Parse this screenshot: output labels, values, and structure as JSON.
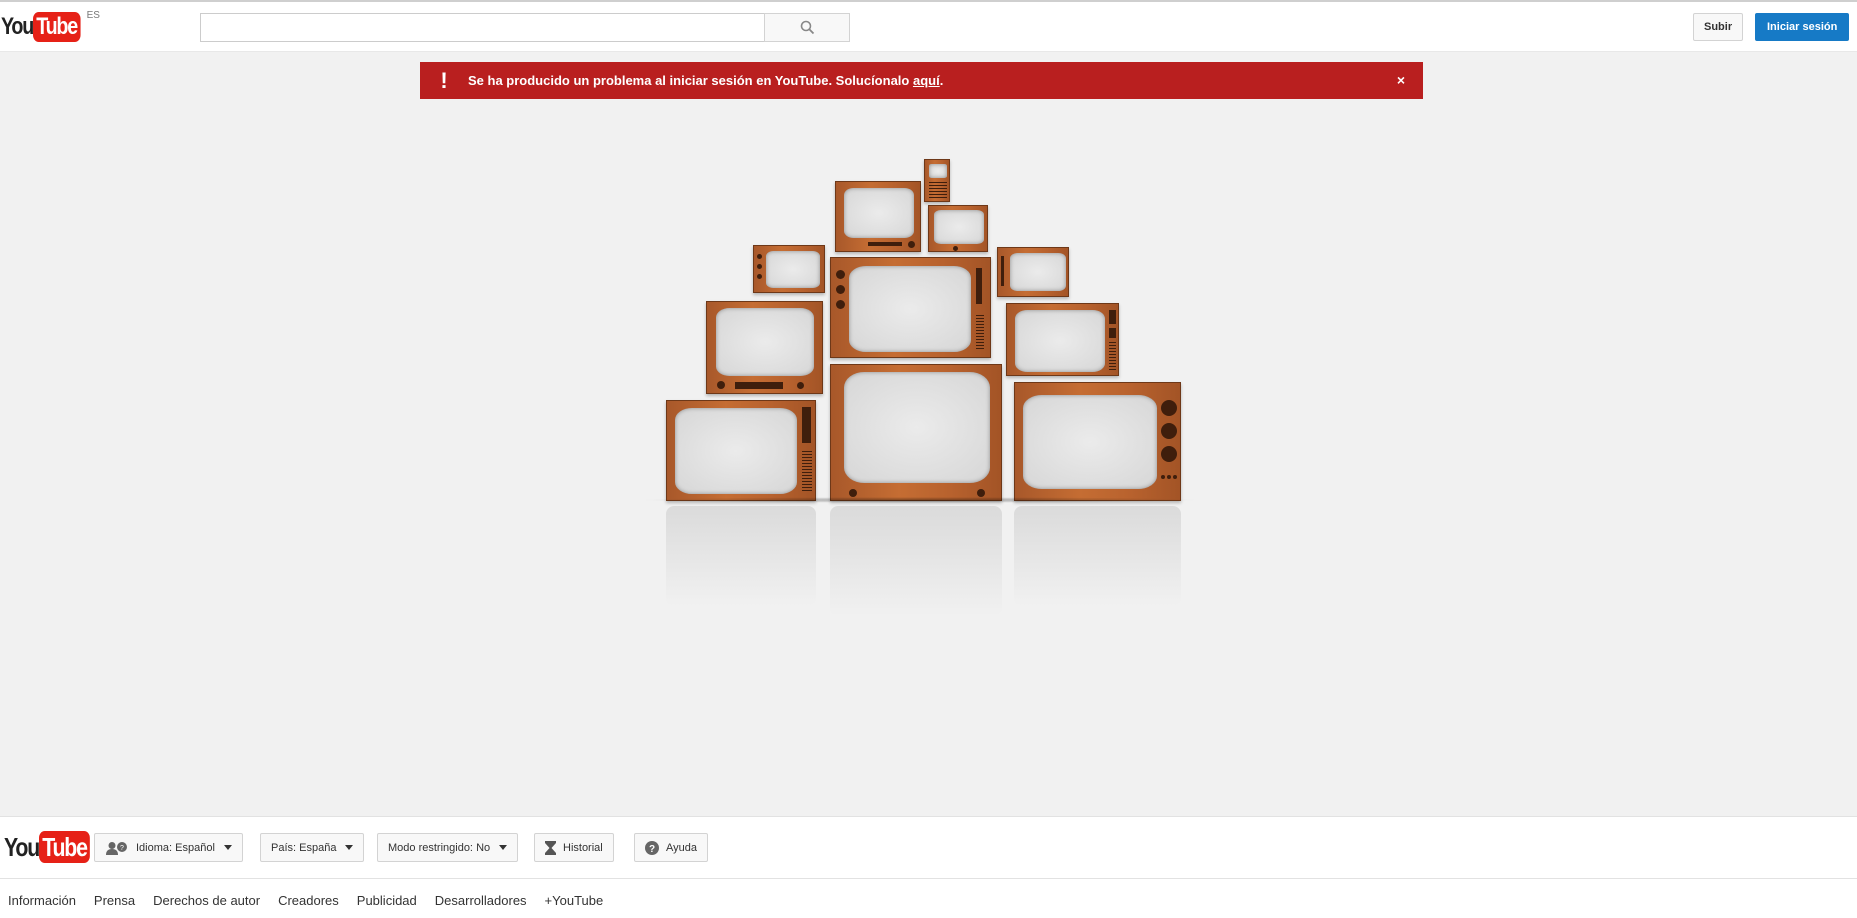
{
  "masthead": {
    "logo_you": "You",
    "logo_tube": "Tube",
    "country_code": "ES",
    "search": {
      "value": "",
      "placeholder": ""
    },
    "upload_label": "Subir",
    "signin_label": "Iniciar sesión"
  },
  "alert": {
    "message": "Se ha producido un problema al iniciar sesión en YouTube. Solucíonalo ",
    "link_text": "aquí",
    "suffix": ".",
    "icon": "!",
    "close": "×",
    "color": "#b91f1f"
  },
  "footer": {
    "logo_you": "You",
    "logo_tube": "Tube",
    "language": {
      "label": "Idioma:",
      "value": "Español"
    },
    "country": {
      "label": "País:",
      "value": "España"
    },
    "restricted": {
      "label": "Modo restringido:",
      "value": "No"
    },
    "history_label": "Historial",
    "help_label": "Ayuda",
    "links": [
      "Información",
      "Prensa",
      "Derechos de autor",
      "Creadores",
      "Publicidad",
      "Desarrolladores",
      "+YouTube"
    ]
  },
  "colors": {
    "brand_red": "#e62117",
    "signin_blue": "#167ac6",
    "background": "#f1f1f1"
  }
}
